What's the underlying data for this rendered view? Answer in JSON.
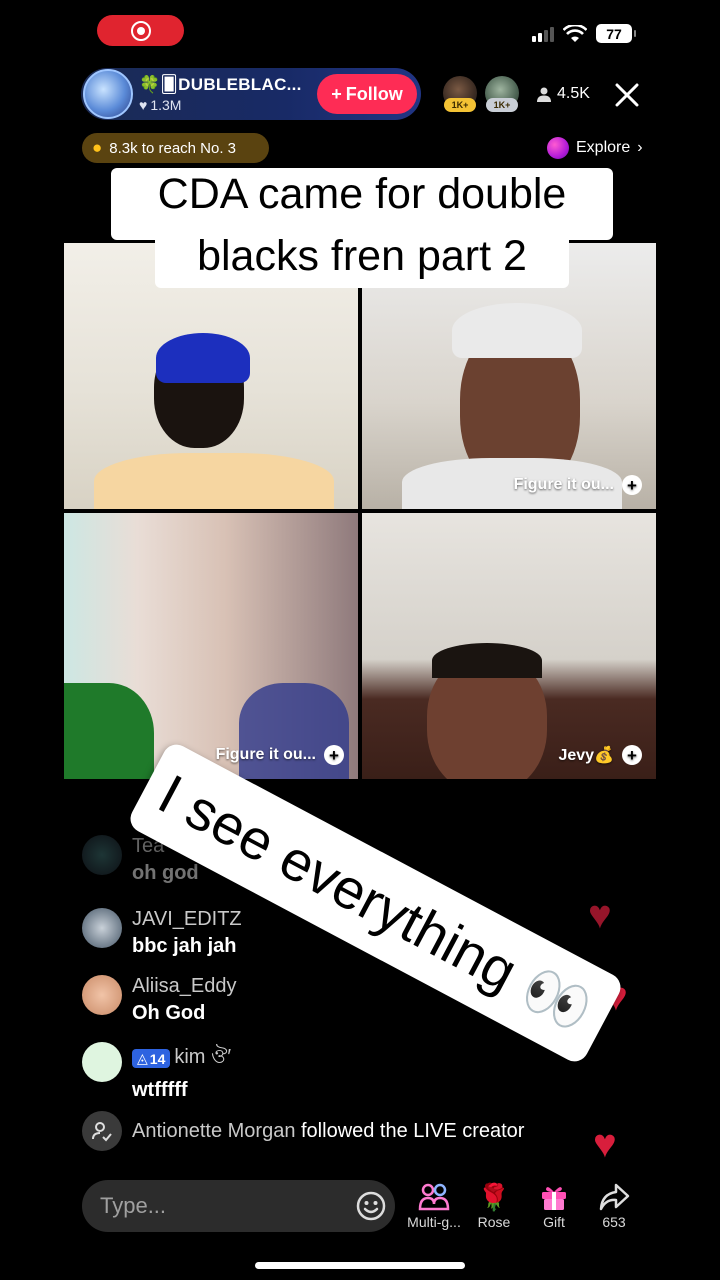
{
  "status_bar": {
    "battery": "77"
  },
  "host": {
    "name": "DUBLEBLAC...",
    "name_prefix": "🍀🂠",
    "likes": "1.3M",
    "follow_label": "Follow"
  },
  "viewers": {
    "badge1": "1K+",
    "badge2": "1K+",
    "count": "4.5K"
  },
  "rank": {
    "text": "8.3k to reach No. 3"
  },
  "explore": {
    "label": "Explore"
  },
  "caption": {
    "line1": "CDA came for double",
    "line2": "blacks fren part 2"
  },
  "tiles": [
    {
      "label": ""
    },
    {
      "label": "Figure it ou..."
    },
    {
      "label": "Figure it ou..."
    },
    {
      "label": "Jevy💰"
    }
  ],
  "comments": [
    {
      "user": "Tea",
      "text": "oh god"
    },
    {
      "user": "JAVI_EDITZ",
      "text": "bbc jah jah"
    },
    {
      "user": "Aliisa_Eddy",
      "text": "Oh God"
    },
    {
      "level": "14",
      "user": "kim ঔ′",
      "text": "wtfffff"
    }
  ],
  "follow_event": {
    "user": "Antionette Morgan",
    "text": "followed the LIVE creator"
  },
  "sticker": {
    "text": "I see everything 👀"
  },
  "bottom_bar": {
    "input_placeholder": "Type...",
    "actions": [
      {
        "label": "Multi-g..."
      },
      {
        "label": "Rose"
      },
      {
        "label": "Gift"
      },
      {
        "label": "653"
      }
    ]
  },
  "colors": {
    "follow": "#fe2c55",
    "heart": "#d81e3c",
    "record": "#e0242f"
  }
}
